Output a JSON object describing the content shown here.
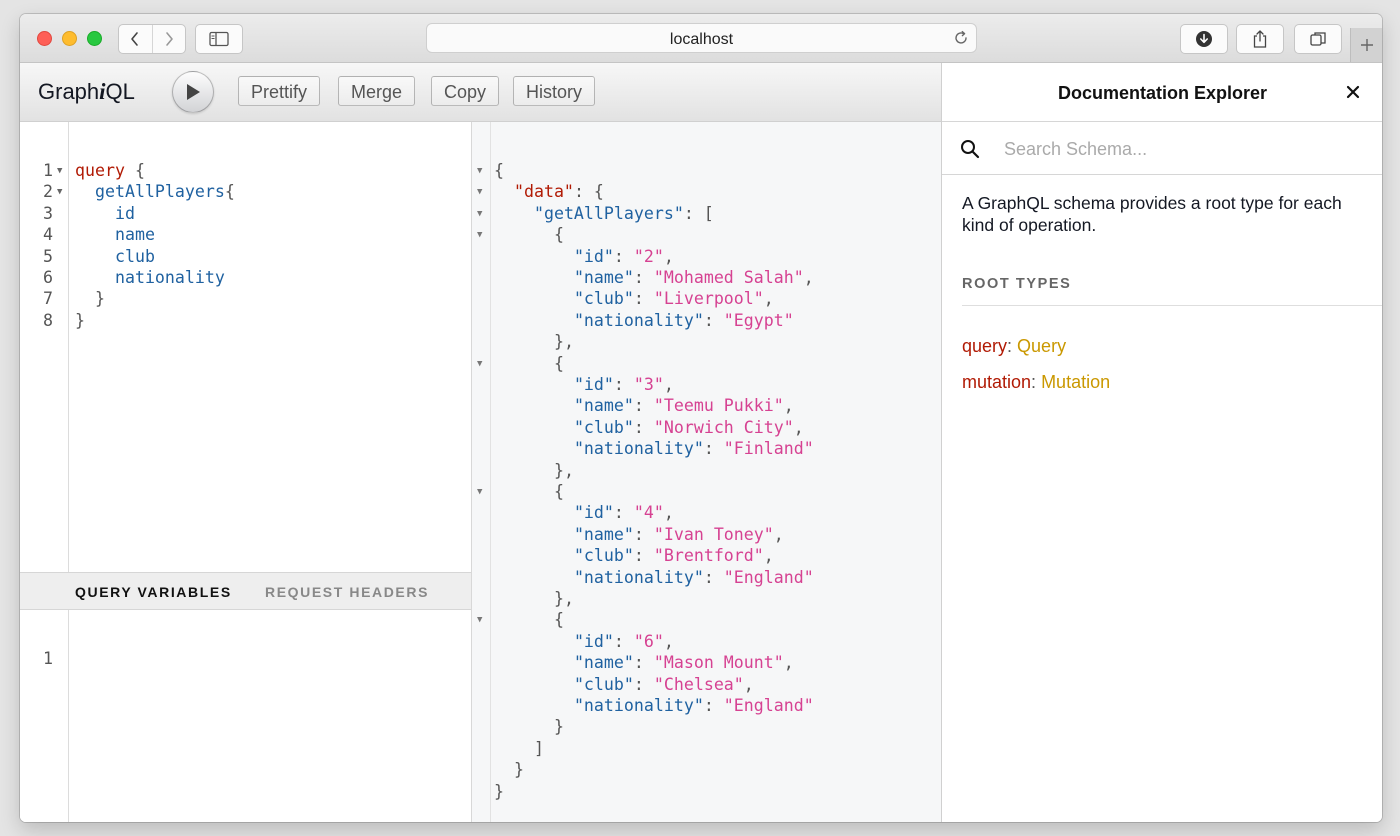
{
  "browser": {
    "url": "localhost"
  },
  "toolbar": {
    "logo_prefix": "Graph",
    "logo_i": "i",
    "logo_suffix": "QL",
    "prettify": "Prettify",
    "merge": "Merge",
    "copy": "Copy",
    "history": "History"
  },
  "query_editor": {
    "line_numbers": [
      "1",
      "2",
      "3",
      "4",
      "5",
      "6",
      "7",
      "8"
    ],
    "lines": [
      {
        "tokens": [
          {
            "t": "query",
            "c": "kw"
          },
          {
            "t": " {",
            "c": "pn"
          }
        ]
      },
      {
        "tokens": [
          {
            "t": "  "
          },
          {
            "t": "getAllPlayers",
            "c": "fld"
          },
          {
            "t": "{",
            "c": "pn"
          }
        ]
      },
      {
        "tokens": [
          {
            "t": "    "
          },
          {
            "t": "id",
            "c": "fld"
          }
        ]
      },
      {
        "tokens": [
          {
            "t": "    "
          },
          {
            "t": "name",
            "c": "fld"
          }
        ]
      },
      {
        "tokens": [
          {
            "t": "    "
          },
          {
            "t": "club",
            "c": "fld"
          }
        ]
      },
      {
        "tokens": [
          {
            "t": "    "
          },
          {
            "t": "nationality",
            "c": "fld"
          }
        ]
      },
      {
        "tokens": [
          {
            "t": "  "
          },
          {
            "t": "}",
            "c": "pn"
          }
        ]
      },
      {
        "tokens": [
          {
            "t": "}",
            "c": "pn"
          }
        ]
      }
    ]
  },
  "variables_panel": {
    "tab_variables": "QUERY VARIABLES",
    "tab_headers": "REQUEST HEADERS",
    "line_numbers": [
      "1"
    ]
  },
  "result": {
    "lines": [
      {
        "tokens": [
          {
            "t": "{",
            "c": "pn"
          }
        ]
      },
      {
        "tokens": [
          {
            "t": "  "
          },
          {
            "t": "\"data\"",
            "c": "kw"
          },
          {
            "t": ": {",
            "c": "pn"
          }
        ]
      },
      {
        "tokens": [
          {
            "t": "    "
          },
          {
            "t": "\"getAllPlayers\"",
            "c": "fld"
          },
          {
            "t": ": [",
            "c": "pn"
          }
        ]
      },
      {
        "tokens": [
          {
            "t": "      "
          },
          {
            "t": "{",
            "c": "pn"
          }
        ]
      },
      {
        "tokens": [
          {
            "t": "        "
          },
          {
            "t": "\"id\"",
            "c": "fld"
          },
          {
            "t": ": ",
            "c": "pn"
          },
          {
            "t": "\"2\"",
            "c": "str"
          },
          {
            "t": ",",
            "c": "pn"
          }
        ]
      },
      {
        "tokens": [
          {
            "t": "        "
          },
          {
            "t": "\"name\"",
            "c": "fld"
          },
          {
            "t": ": ",
            "c": "pn"
          },
          {
            "t": "\"Mohamed Salah\"",
            "c": "str"
          },
          {
            "t": ",",
            "c": "pn"
          }
        ]
      },
      {
        "tokens": [
          {
            "t": "        "
          },
          {
            "t": "\"club\"",
            "c": "fld"
          },
          {
            "t": ": ",
            "c": "pn"
          },
          {
            "t": "\"Liverpool\"",
            "c": "str"
          },
          {
            "t": ",",
            "c": "pn"
          }
        ]
      },
      {
        "tokens": [
          {
            "t": "        "
          },
          {
            "t": "\"nationality\"",
            "c": "fld"
          },
          {
            "t": ": ",
            "c": "pn"
          },
          {
            "t": "\"Egypt\"",
            "c": "str"
          }
        ]
      },
      {
        "tokens": [
          {
            "t": "      "
          },
          {
            "t": "},",
            "c": "pn"
          }
        ]
      },
      {
        "tokens": [
          {
            "t": "      "
          },
          {
            "t": "{",
            "c": "pn"
          }
        ]
      },
      {
        "tokens": [
          {
            "t": "        "
          },
          {
            "t": "\"id\"",
            "c": "fld"
          },
          {
            "t": ": ",
            "c": "pn"
          },
          {
            "t": "\"3\"",
            "c": "str"
          },
          {
            "t": ",",
            "c": "pn"
          }
        ]
      },
      {
        "tokens": [
          {
            "t": "        "
          },
          {
            "t": "\"name\"",
            "c": "fld"
          },
          {
            "t": ": ",
            "c": "pn"
          },
          {
            "t": "\"Teemu Pukki\"",
            "c": "str"
          },
          {
            "t": ",",
            "c": "pn"
          }
        ]
      },
      {
        "tokens": [
          {
            "t": "        "
          },
          {
            "t": "\"club\"",
            "c": "fld"
          },
          {
            "t": ": ",
            "c": "pn"
          },
          {
            "t": "\"Norwich City\"",
            "c": "str"
          },
          {
            "t": ",",
            "c": "pn"
          }
        ]
      },
      {
        "tokens": [
          {
            "t": "        "
          },
          {
            "t": "\"nationality\"",
            "c": "fld"
          },
          {
            "t": ": ",
            "c": "pn"
          },
          {
            "t": "\"Finland\"",
            "c": "str"
          }
        ]
      },
      {
        "tokens": [
          {
            "t": "      "
          },
          {
            "t": "},",
            "c": "pn"
          }
        ]
      },
      {
        "tokens": [
          {
            "t": "      "
          },
          {
            "t": "{",
            "c": "pn"
          }
        ]
      },
      {
        "tokens": [
          {
            "t": "        "
          },
          {
            "t": "\"id\"",
            "c": "fld"
          },
          {
            "t": ": ",
            "c": "pn"
          },
          {
            "t": "\"4\"",
            "c": "str"
          },
          {
            "t": ",",
            "c": "pn"
          }
        ]
      },
      {
        "tokens": [
          {
            "t": "        "
          },
          {
            "t": "\"name\"",
            "c": "fld"
          },
          {
            "t": ": ",
            "c": "pn"
          },
          {
            "t": "\"Ivan Toney\"",
            "c": "str"
          },
          {
            "t": ",",
            "c": "pn"
          }
        ]
      },
      {
        "tokens": [
          {
            "t": "        "
          },
          {
            "t": "\"club\"",
            "c": "fld"
          },
          {
            "t": ": ",
            "c": "pn"
          },
          {
            "t": "\"Brentford\"",
            "c": "str"
          },
          {
            "t": ",",
            "c": "pn"
          }
        ]
      },
      {
        "tokens": [
          {
            "t": "        "
          },
          {
            "t": "\"nationality\"",
            "c": "fld"
          },
          {
            "t": ": ",
            "c": "pn"
          },
          {
            "t": "\"England\"",
            "c": "str"
          }
        ]
      },
      {
        "tokens": [
          {
            "t": "      "
          },
          {
            "t": "},",
            "c": "pn"
          }
        ]
      },
      {
        "tokens": [
          {
            "t": "      "
          },
          {
            "t": "{",
            "c": "pn"
          }
        ]
      },
      {
        "tokens": [
          {
            "t": "        "
          },
          {
            "t": "\"id\"",
            "c": "fld"
          },
          {
            "t": ": ",
            "c": "pn"
          },
          {
            "t": "\"6\"",
            "c": "str"
          },
          {
            "t": ",",
            "c": "pn"
          }
        ]
      },
      {
        "tokens": [
          {
            "t": "        "
          },
          {
            "t": "\"name\"",
            "c": "fld"
          },
          {
            "t": ": ",
            "c": "pn"
          },
          {
            "t": "\"Mason Mount\"",
            "c": "str"
          },
          {
            "t": ",",
            "c": "pn"
          }
        ]
      },
      {
        "tokens": [
          {
            "t": "        "
          },
          {
            "t": "\"club\"",
            "c": "fld"
          },
          {
            "t": ": ",
            "c": "pn"
          },
          {
            "t": "\"Chelsea\"",
            "c": "str"
          },
          {
            "t": ",",
            "c": "pn"
          }
        ]
      },
      {
        "tokens": [
          {
            "t": "        "
          },
          {
            "t": "\"nationality\"",
            "c": "fld"
          },
          {
            "t": ": ",
            "c": "pn"
          },
          {
            "t": "\"England\"",
            "c": "str"
          }
        ]
      },
      {
        "tokens": [
          {
            "t": "      "
          },
          {
            "t": "}",
            "c": "pn"
          }
        ]
      },
      {
        "tokens": [
          {
            "t": "    "
          },
          {
            "t": "]",
            "c": "pn"
          }
        ]
      },
      {
        "tokens": [
          {
            "t": "  "
          },
          {
            "t": "}",
            "c": "pn"
          }
        ]
      },
      {
        "tokens": [
          {
            "t": "}",
            "c": "pn"
          }
        ]
      }
    ]
  },
  "docs": {
    "title": "Documentation Explorer",
    "search_placeholder": "Search Schema...",
    "description": "A GraphQL schema provides a root type for each kind of operation.",
    "root_types_label": "ROOT TYPES",
    "root_types": [
      {
        "key": "query",
        "sep": ": ",
        "type": "Query"
      },
      {
        "key": "mutation",
        "sep": ": ",
        "type": "Mutation"
      }
    ]
  },
  "colors": {
    "keyword": "#b11a04",
    "field": "#1f61a0",
    "string": "#d64292",
    "type": "#ca9800"
  },
  "icons": {
    "back": "chevron-left-icon",
    "forward": "chevron-right-icon",
    "sidebar": "sidebar-icon",
    "reload": "reload-icon",
    "download": "download-icon",
    "share": "share-icon",
    "tabs": "tabs-icon",
    "new_tab": "plus-icon",
    "run": "play-icon",
    "close": "close-icon",
    "search": "search-icon",
    "fold": "fold-arrow-icon"
  }
}
